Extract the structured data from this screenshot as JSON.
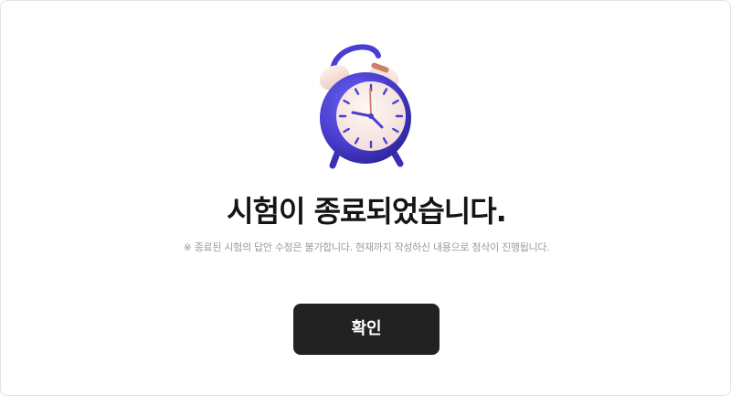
{
  "dialog": {
    "title": "시험이 종료되었습니다.",
    "notice": "※ 종료된 시험의 답안 수정은 불가합니다. 현재까지 작성하신 내용으로 첨삭이 진행됩니다.",
    "confirm_label": "확인",
    "illustration_icon": "alarm-clock-icon"
  },
  "colors": {
    "clock_body": "#4a3fd0",
    "clock_face": "#fbeeea",
    "button_bg": "#222222",
    "button_text": "#ffffff",
    "title": "#141414",
    "notice": "#9a9a9a"
  }
}
